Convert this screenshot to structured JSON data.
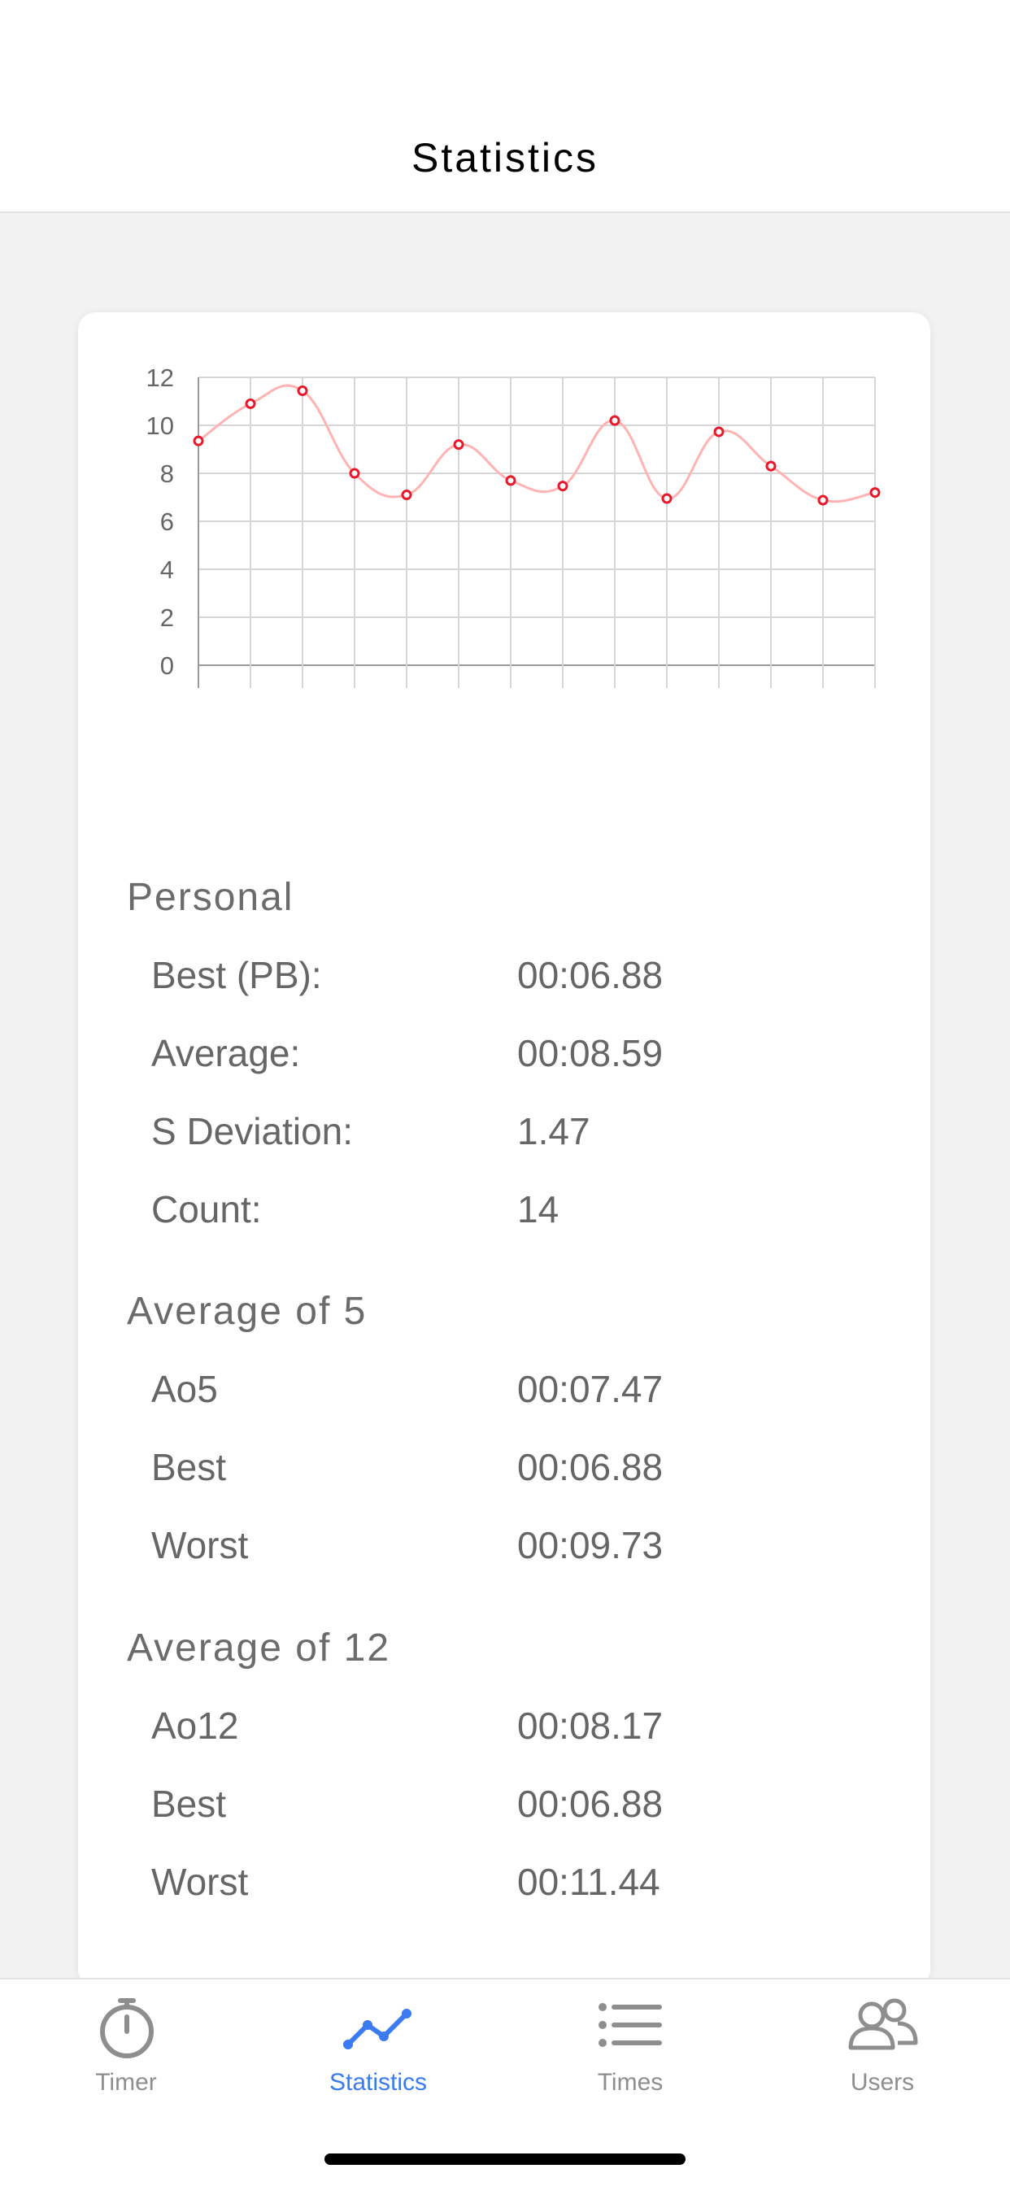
{
  "header": {
    "title": "Statistics"
  },
  "chart_data": {
    "type": "line",
    "x": [
      1,
      2,
      3,
      4,
      5,
      6,
      7,
      8,
      9,
      10,
      11,
      12,
      13,
      14
    ],
    "values": [
      9.35,
      10.9,
      11.44,
      8.0,
      7.1,
      9.2,
      7.7,
      7.47,
      10.2,
      6.95,
      9.73,
      8.3,
      6.88,
      7.2
    ],
    "ylim": [
      0,
      12
    ],
    "yticks": [
      "0",
      "2",
      "4",
      "6",
      "8",
      "10",
      "12"
    ],
    "grid": true,
    "colors": {
      "line": "#ffb3b3",
      "point": "#e8182a",
      "grid": "#d6d6d6",
      "axis": "#9a9a9a"
    }
  },
  "stats": {
    "personal": {
      "title": "Personal",
      "rows": [
        {
          "label": "Best (PB):",
          "value": "00:06.88"
        },
        {
          "label": "Average:",
          "value": "00:08.59"
        },
        {
          "label": "S Deviation:",
          "value": "1.47"
        },
        {
          "label": "Count:",
          "value": "14"
        }
      ]
    },
    "ao5": {
      "title": "Average of 5",
      "rows": [
        {
          "label": "Ao5",
          "value": "00:07.47"
        },
        {
          "label": "Best",
          "value": "00:06.88"
        },
        {
          "label": "Worst",
          "value": "00:09.73"
        }
      ]
    },
    "ao12": {
      "title": "Average of 12",
      "rows": [
        {
          "label": "Ao12",
          "value": "00:08.17"
        },
        {
          "label": "Best",
          "value": "00:06.88"
        },
        {
          "label": "Worst",
          "value": "00:11.44"
        }
      ]
    }
  },
  "tabbar": {
    "tabs": [
      {
        "label": "Timer",
        "icon": "stopwatch-icon",
        "active": false
      },
      {
        "label": "Statistics",
        "icon": "line-chart-icon",
        "active": true
      },
      {
        "label": "Times",
        "icon": "list-icon",
        "active": false
      },
      {
        "label": "Users",
        "icon": "users-icon",
        "active": false
      }
    ],
    "colors": {
      "active": "#3a7bf2",
      "inactive": "#8e8e8e"
    }
  }
}
